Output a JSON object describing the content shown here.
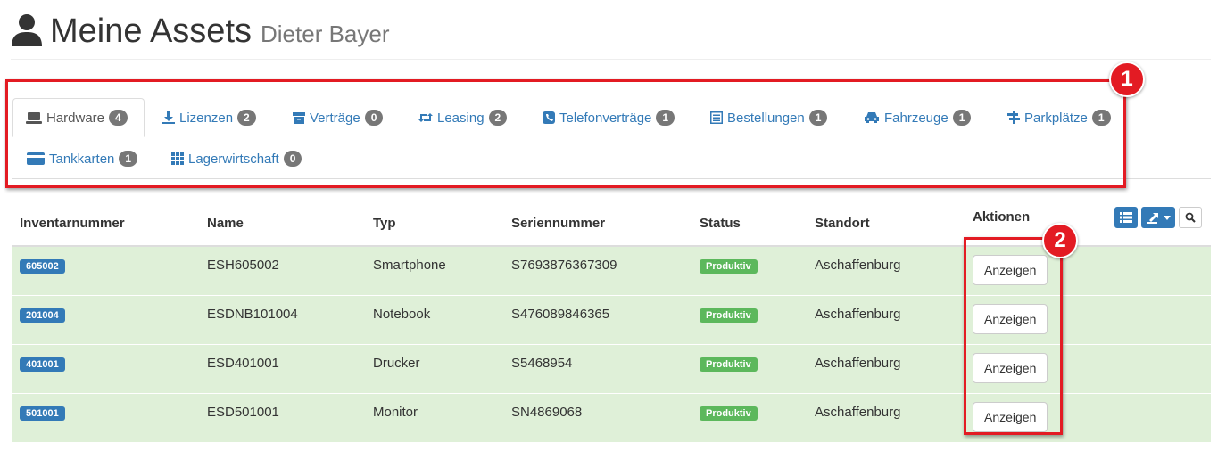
{
  "header": {
    "title": "Meine Assets",
    "subtitle": "Dieter Bayer",
    "icon": "user-icon"
  },
  "tabs": [
    {
      "label": "Hardware",
      "count": "4",
      "icon": "laptop-icon",
      "active": true
    },
    {
      "label": "Lizenzen",
      "count": "2",
      "icon": "download-icon"
    },
    {
      "label": "Verträge",
      "count": "0",
      "icon": "archive-icon"
    },
    {
      "label": "Leasing",
      "count": "2",
      "icon": "retweet-icon"
    },
    {
      "label": "Telefonverträge",
      "count": "1",
      "icon": "phone-icon"
    },
    {
      "label": "Bestellungen",
      "count": "1",
      "icon": "list-alt-icon"
    },
    {
      "label": "Fahrzeuge",
      "count": "1",
      "icon": "car-icon"
    },
    {
      "label": "Parkplätze",
      "count": "1",
      "icon": "signpost-icon"
    },
    {
      "label": "Tankkarten",
      "count": "1",
      "icon": "credit-card-icon"
    },
    {
      "label": "Lagerwirtschaft",
      "count": "0",
      "icon": "grid-icon"
    }
  ],
  "annotations": [
    "1",
    "2"
  ],
  "table": {
    "columns": [
      "Inventarnummer",
      "Name",
      "Typ",
      "Seriennummer",
      "Status",
      "Standort",
      "Aktionen"
    ],
    "rows": [
      {
        "inv": "605002",
        "name": "ESH605002",
        "typ": "Smartphone",
        "serial": "S7693876367309",
        "status": "Produktiv",
        "standort": "Aschaffenburg",
        "action": "Anzeigen"
      },
      {
        "inv": "201004",
        "name": "ESDNB101004",
        "typ": "Notebook",
        "serial": "S476089846365",
        "status": "Produktiv",
        "standort": "Aschaffenburg",
        "action": "Anzeigen"
      },
      {
        "inv": "401001",
        "name": "ESD401001",
        "typ": "Drucker",
        "serial": "S5468954",
        "status": "Produktiv",
        "standort": "Aschaffenburg",
        "action": "Anzeigen"
      },
      {
        "inv": "501001",
        "name": "ESD501001",
        "typ": "Monitor",
        "serial": "SN4869068",
        "status": "Produktiv",
        "standort": "Aschaffenburg",
        "action": "Anzeigen"
      }
    ]
  },
  "toolbar": {
    "icons": [
      "list-view-icon",
      "export-icon",
      "search-icon"
    ]
  },
  "colors": {
    "link": "#337ab7",
    "badge": "#777777",
    "row_success": "#dff0d8",
    "label_primary": "#337ab7",
    "label_success": "#5cb85c",
    "annotation": "#e31b23"
  }
}
